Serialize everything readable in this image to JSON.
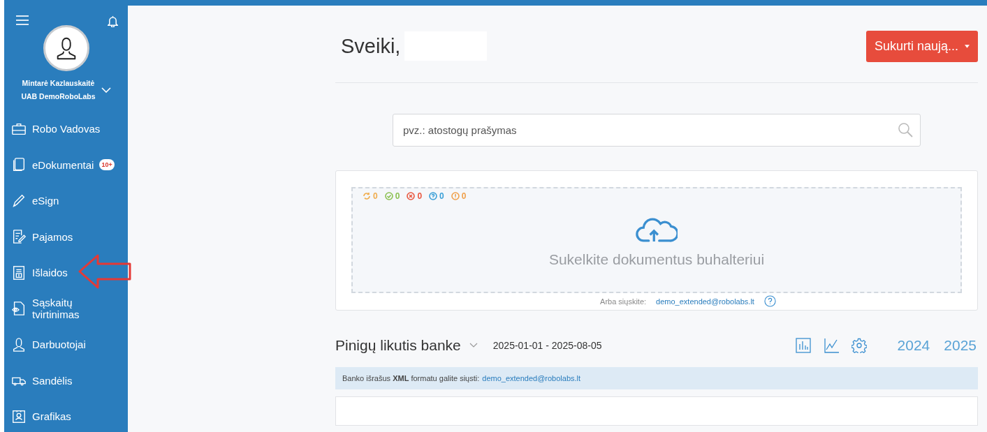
{
  "sidebar": {
    "user": {
      "name": "Mintarė Kazlauskaitė",
      "company": "UAB DemoRoboLabs"
    },
    "items": [
      {
        "label": "Robo Vadovas",
        "kind": "briefcase"
      },
      {
        "label": "eDokumentai",
        "kind": "documents",
        "badge": "10+"
      },
      {
        "label": "eSign",
        "kind": "pen"
      },
      {
        "label": "Pajamos",
        "kind": "edit"
      },
      {
        "label": "Išlaidos",
        "kind": "receipt",
        "annotated": true
      },
      {
        "label": "Sąskaitų tvirtinimas",
        "kind": "eye"
      },
      {
        "label": "Darbuotojai",
        "kind": "person"
      },
      {
        "label": "Sandėlis",
        "kind": "truck"
      },
      {
        "label": "Grafikas",
        "kind": "badge"
      }
    ]
  },
  "header": {
    "greeting": "Sveiki,",
    "create_button": "Sukurti naują..."
  },
  "search": {
    "placeholder": "pvz.: atostogų prašymas"
  },
  "upload": {
    "counters": [
      {
        "kind": "pending",
        "count": "0",
        "color": "#f0ad4e"
      },
      {
        "kind": "done",
        "count": "0",
        "color": "#8cc152"
      },
      {
        "kind": "failed",
        "count": "0",
        "color": "#e9573f"
      },
      {
        "kind": "question",
        "count": "0",
        "color": "#3ba0d8"
      },
      {
        "kind": "warning",
        "count": "0",
        "color": "#f0a04b"
      }
    ],
    "prompt": "Sukelkite dokumentus buhalteriui",
    "send_label": "Arba siųskite:",
    "email": "demo_extended@robolabs.lt"
  },
  "bank": {
    "title": "Pinigų likutis banke",
    "period": "2025-01-01 - 2025-08-05",
    "years": [
      {
        "label": "2024",
        "selected": false
      },
      {
        "label": "2025",
        "selected": false
      }
    ],
    "notice": "Banko išrašus **XML** formatu galite siųsti:",
    "notice_email": "demo_extended@robolabs.lt"
  }
}
